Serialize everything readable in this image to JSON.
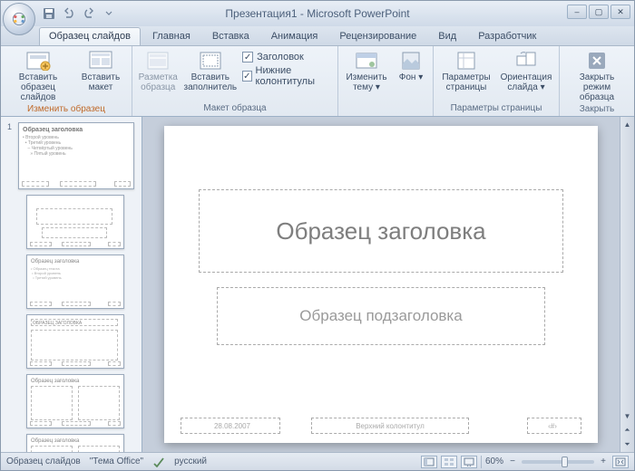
{
  "title": "Презентация1 - Microsoft PowerPoint",
  "tabs": {
    "master": "Образец слайдов",
    "home": "Главная",
    "insert": "Вставка",
    "animation": "Анимация",
    "review": "Рецензирование",
    "view": "Вид",
    "developer": "Разработчик"
  },
  "ribbon": {
    "edit_master": {
      "insert_master": "Вставить образец слайдов",
      "insert_layout": "Вставить макет",
      "group_label": "Изменить образец"
    },
    "master_layout": {
      "layout": "Разметка образца",
      "placeholder": "Вставить заполнитель",
      "chk_title": "Заголовок",
      "chk_footers": "Нижние колонтитулы",
      "group_label": "Макет образца"
    },
    "edit_theme": {
      "themes": "Изменить тему",
      "background": "Фон"
    },
    "page_setup": {
      "setup": "Параметры страницы",
      "orientation": "Ориентация слайда",
      "group_label": "Параметры страницы"
    },
    "close": {
      "close_master": "Закрыть режим образца",
      "group_label": "Закрыть"
    }
  },
  "thumb_index": "1",
  "master_thumb_title": "Образец заголовка",
  "slide": {
    "title_ph": "Образец заголовка",
    "subtitle_ph": "Образец подзаголовка",
    "date_ph": "28.08.2007",
    "footer_ph": "Верхний колонтитул",
    "num_ph": "‹#›"
  },
  "status": {
    "mode": "Образец слайдов",
    "theme": "\"Тема Office\"",
    "lang": "русский",
    "zoom": "60%"
  }
}
